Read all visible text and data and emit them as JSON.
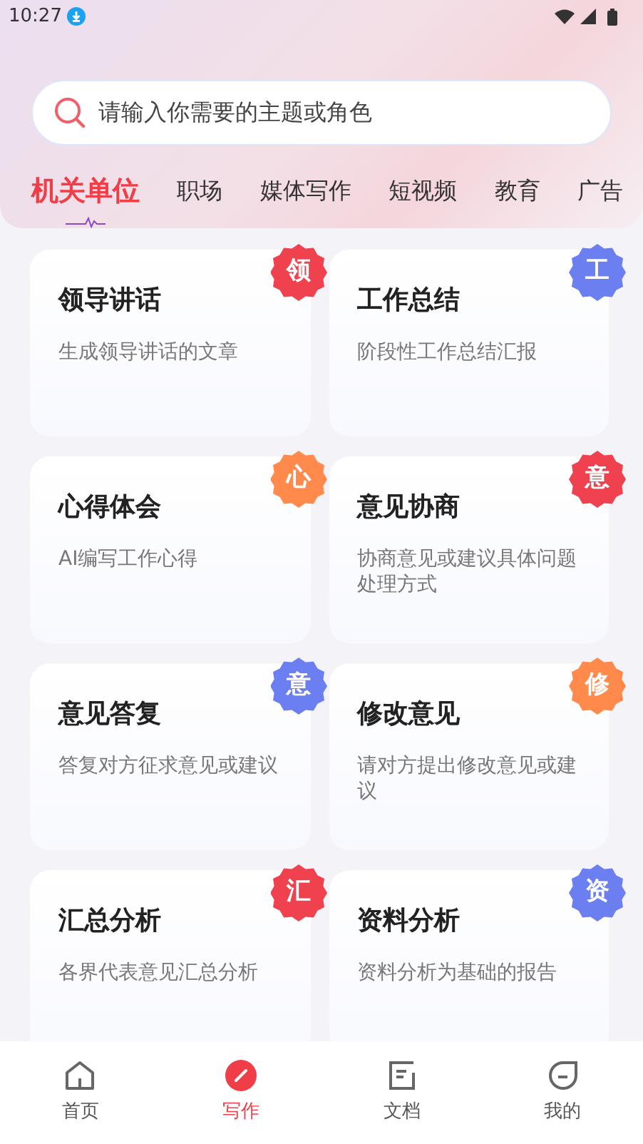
{
  "status_bar": {
    "time": "10:27"
  },
  "search": {
    "placeholder": "请输入你需要的主题或角色"
  },
  "tabs": [
    {
      "label": "机关单位",
      "selected": true
    },
    {
      "label": "职场",
      "selected": false
    },
    {
      "label": "媒体写作",
      "selected": false
    },
    {
      "label": "短视频",
      "selected": false
    },
    {
      "label": "教育",
      "selected": false
    },
    {
      "label": "广告",
      "selected": false
    }
  ],
  "cards": [
    {
      "badge": "领",
      "color": "#f0414f",
      "title": "领导讲话",
      "description": "生成领导讲话的文章"
    },
    {
      "badge": "工",
      "color": "#6b7ff0",
      "title": "工作总结",
      "description": "阶段性工作总结汇报"
    },
    {
      "badge": "心",
      "color": "#ff8a4c",
      "title": "心得体会",
      "description": "AI编写工作心得"
    },
    {
      "badge": "意",
      "color": "#f0414f",
      "title": "意见协商",
      "description": "协商意见或建议具体问题处理方式"
    },
    {
      "badge": "意",
      "color": "#6b7ff0",
      "title": "意见答复",
      "description": "答复对方征求意见或建议"
    },
    {
      "badge": "修",
      "color": "#ff8a4c",
      "title": "修改意见",
      "description": "请对方提出修改意见或建议"
    },
    {
      "badge": "汇",
      "color": "#f0414f",
      "title": "汇总分析",
      "description": "各界代表意见汇总分析"
    },
    {
      "badge": "资",
      "color": "#6b7ff0",
      "title": "资料分析",
      "description": "资料分析为基础的报告"
    }
  ],
  "bottom_nav": [
    {
      "kind": "home",
      "label": "首页",
      "selected": false
    },
    {
      "kind": "write",
      "label": "写作",
      "selected": true
    },
    {
      "kind": "docs",
      "label": "文档",
      "selected": false
    },
    {
      "kind": "profile",
      "label": "我的",
      "selected": false
    }
  ]
}
